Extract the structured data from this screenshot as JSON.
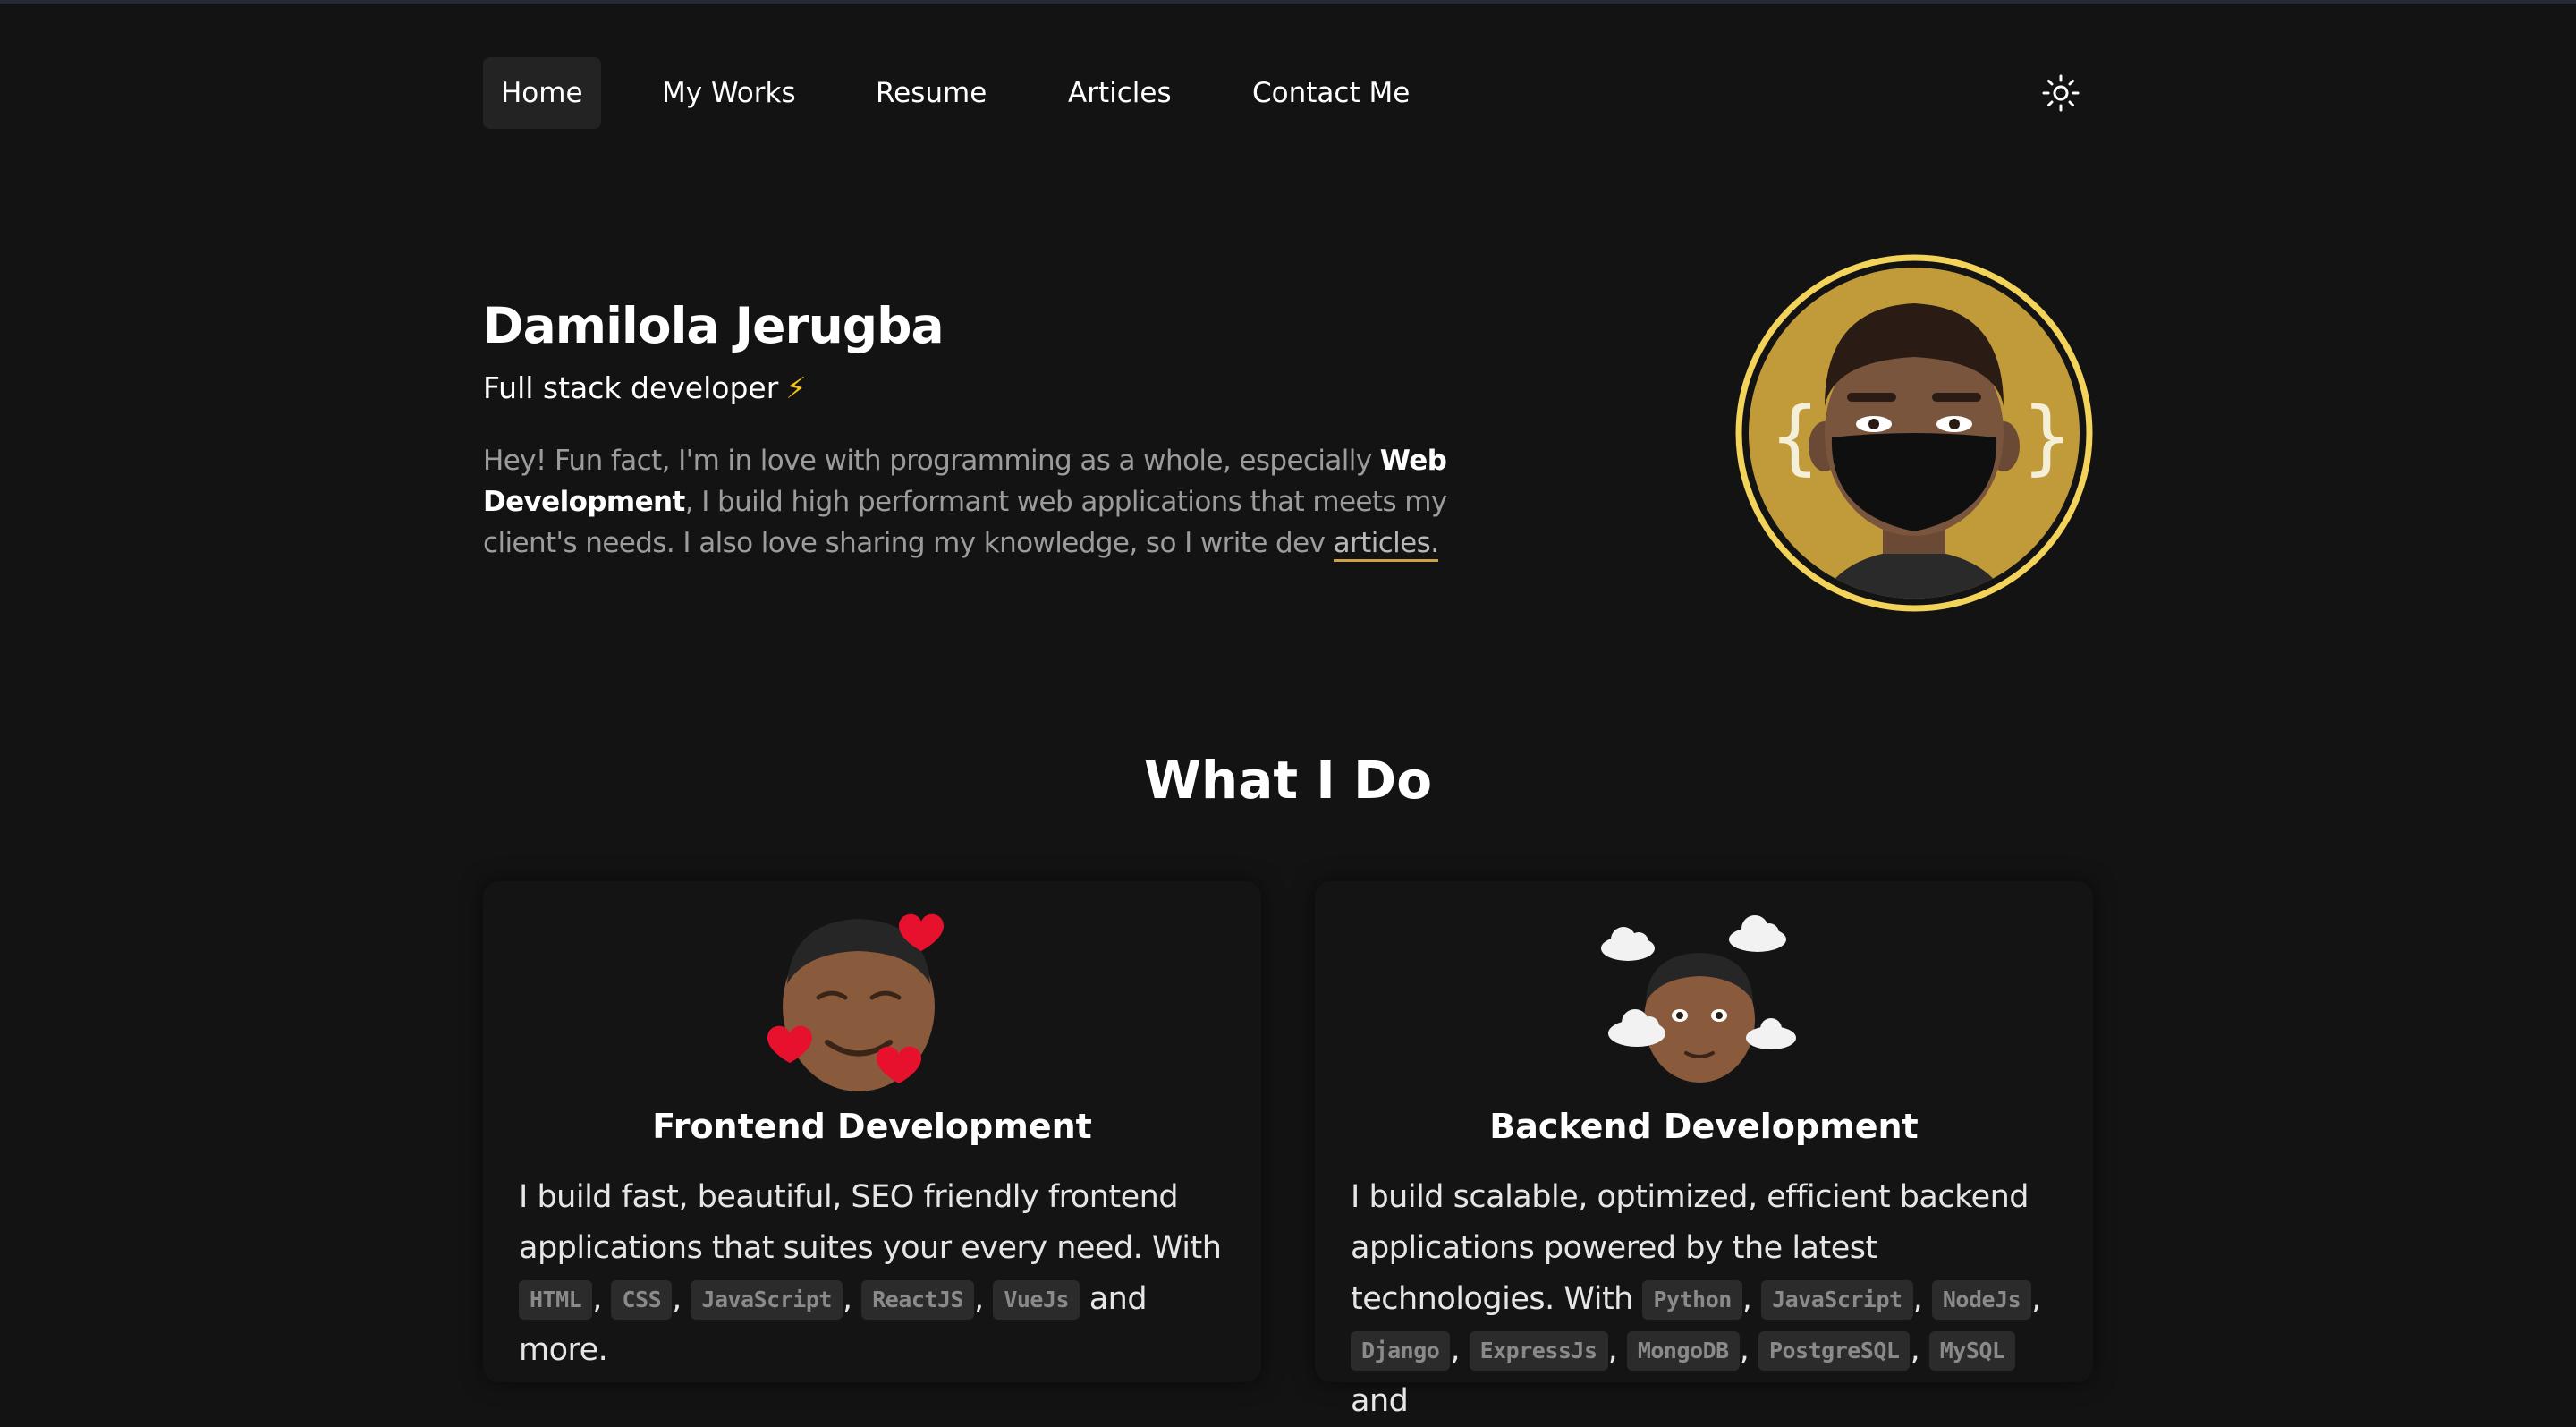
{
  "nav": {
    "items": [
      {
        "label": "Home",
        "active": true
      },
      {
        "label": "My Works"
      },
      {
        "label": "Resume"
      },
      {
        "label": "Articles"
      },
      {
        "label": "Contact Me"
      }
    ],
    "theme_icon": "sun-icon"
  },
  "hero": {
    "name": "Damilola Jerugba",
    "role": "Full stack developer",
    "role_icon": "⚡",
    "bio_part1": "Hey! Fun fact, I'm in love with programming as a whole, especially ",
    "bio_bold": "Web Development",
    "bio_part2": ", I build high performant web applications that meets my client's needs. I also love sharing my knowledge, so I write dev ",
    "bio_link": "articles.",
    "avatar": "memoji-avatar-with-mask"
  },
  "what_i_do": {
    "title": "What I Do",
    "cards": [
      {
        "title": "Frontend Development",
        "emoji": "memoji-with-hearts",
        "desc_intro": "I build fast, beautiful, SEO friendly frontend applications that suites your every need. With",
        "tags": [
          "HTML",
          "CSS",
          "JavaScript",
          "ReactJS",
          "VueJs"
        ],
        "desc_outro": "and more."
      },
      {
        "title": "Backend Development",
        "emoji": "memoji-with-clouds",
        "desc_intro": "I build scalable, optimized, efficient backend applications powered by the latest technologies. With",
        "tags": [
          "Python",
          "JavaScript",
          "NodeJs",
          "Django",
          "ExpressJs",
          "MongoDB",
          "PostgreSQL",
          "MySQL"
        ],
        "desc_outro": "and"
      }
    ]
  },
  "colors": {
    "background": "#131313",
    "accent_gold": "#f3d35a",
    "avatar_bg": "#c19a3a"
  }
}
